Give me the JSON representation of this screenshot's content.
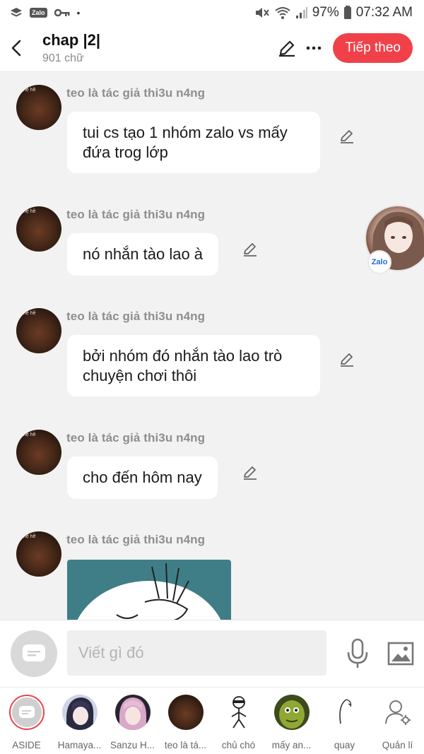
{
  "status_bar": {
    "app_badge": "Zalo",
    "battery": "97%",
    "time": "07:32 AM"
  },
  "header": {
    "title": "chap |2|",
    "subtitle": "901 chữ",
    "next_label": "Tiếp theo"
  },
  "chat": {
    "messages": [
      {
        "sender": "teo là tác giả thi3u n4ng",
        "text": "tui cs tạo 1 nhóm zalo vs mấy đứa trog lớp"
      },
      {
        "sender": "teo là tác giả thi3u n4ng",
        "text": "nó nhắn tào lao à"
      },
      {
        "sender": "teo là tác giả thi3u n4ng",
        "text": "bởi nhóm đó nhắn tào lao trò chuyện chơi thôi"
      },
      {
        "sender": "teo là tác giả thi3u n4ng",
        "text": "cho đến hôm nay"
      },
      {
        "sender": "teo là tác giả thi3u n4ng",
        "text": ""
      }
    ],
    "avatar_caption": "hệ hề",
    "floating_badge": "Zalo"
  },
  "input": {
    "placeholder": "Viết gì đó"
  },
  "tabs": [
    {
      "label": "ASIDE"
    },
    {
      "label": "Hamaya..."
    },
    {
      "label": "Sanzu H..."
    },
    {
      "label": "teo là tá..."
    },
    {
      "label": "chủ chó"
    },
    {
      "label": "mấy an..."
    },
    {
      "label": "quay"
    },
    {
      "label": "Quản lí"
    }
  ],
  "colors": {
    "accent": "#f0414a",
    "background": "#f2f2f2",
    "bubble": "#ffffff"
  }
}
